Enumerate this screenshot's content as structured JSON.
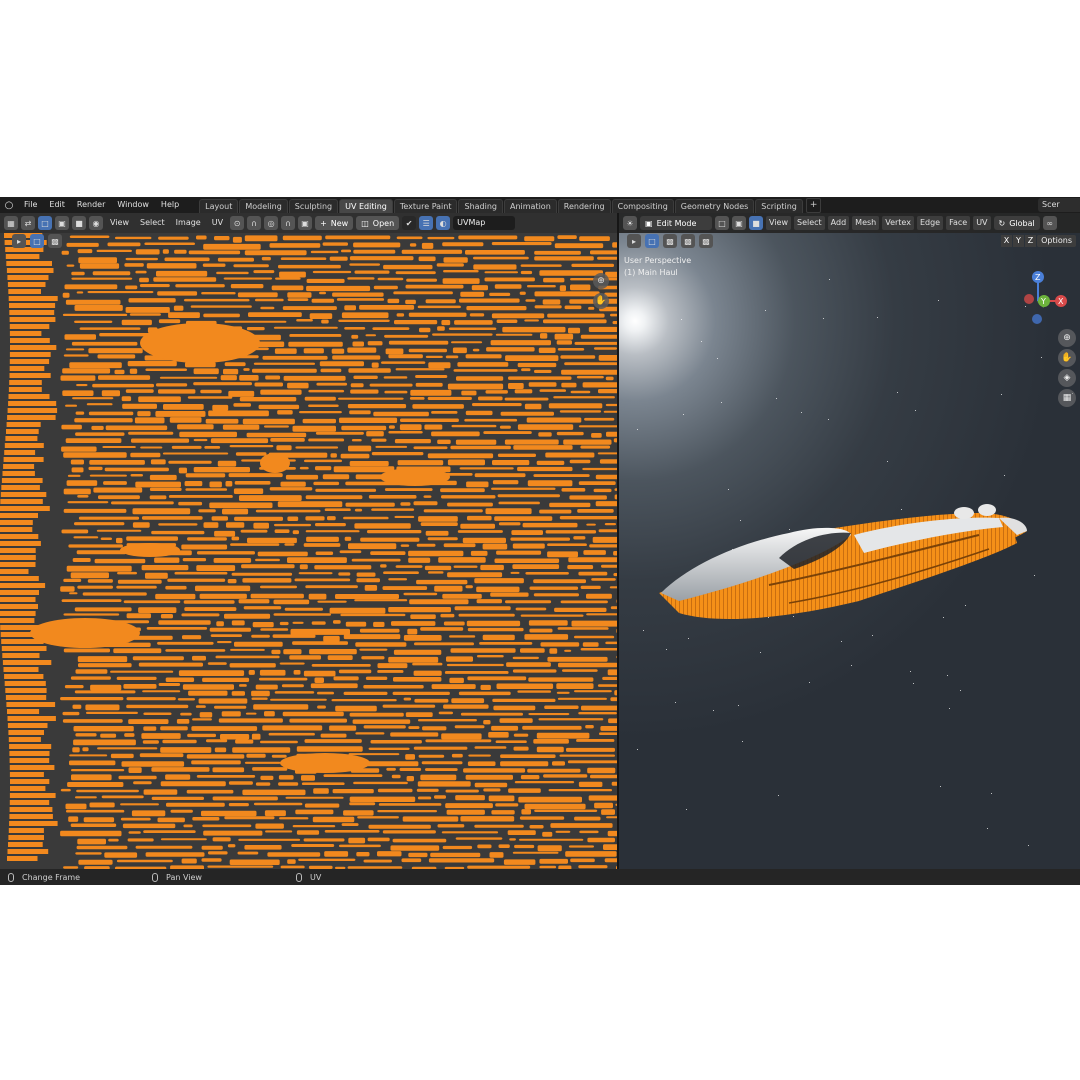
{
  "topbar": {
    "menus": [
      "File",
      "Edit",
      "Render",
      "Window",
      "Help"
    ],
    "workspaces": [
      "Layout",
      "Modeling",
      "Sculpting",
      "UV Editing",
      "Texture Paint",
      "Shading",
      "Animation",
      "Rendering",
      "Compositing",
      "Geometry Nodes",
      "Scripting"
    ],
    "active_workspace": "UV Editing",
    "add_label": "+",
    "scene_label": "Scer"
  },
  "uv_editor": {
    "menus": [
      "View",
      "Select",
      "Image",
      "UV"
    ],
    "new_label": "New",
    "open_label": "Open",
    "uv_map": "UVMap",
    "island_color": "#f2891e",
    "background": "#3a3a3a"
  },
  "viewport": {
    "mode": "Edit Mode",
    "menus": [
      "View",
      "Select",
      "Add",
      "Mesh",
      "Vertex",
      "Edge",
      "Face",
      "UV"
    ],
    "orientation": "Global",
    "axes": [
      "X",
      "Y",
      "Z"
    ],
    "options_label": "Options",
    "info_line1": "User Perspective",
    "info_line2": "(1) Main Haul",
    "gizmo_axes": [
      "Z",
      "Y",
      "X"
    ]
  },
  "statusbar": {
    "items": [
      "Change Frame",
      "Pan View",
      "UV"
    ]
  }
}
